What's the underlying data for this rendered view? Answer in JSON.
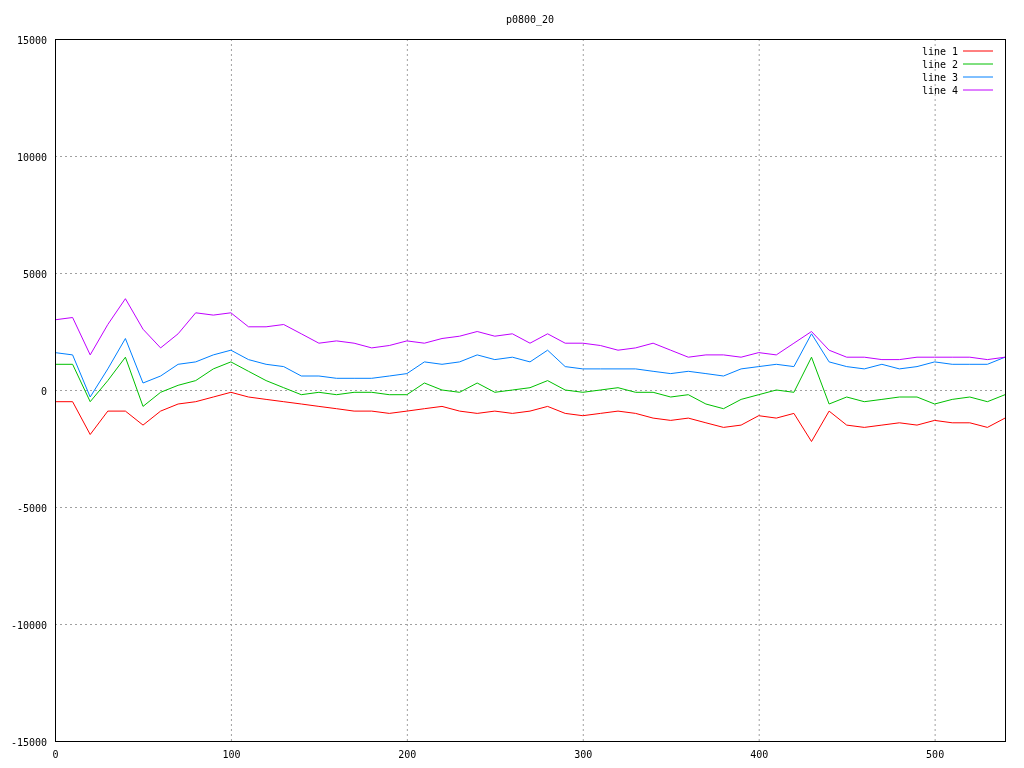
{
  "chart_data": {
    "type": "line",
    "title": "p0800_20",
    "x": [
      0,
      10,
      20,
      30,
      40,
      50,
      60,
      70,
      80,
      90,
      100,
      110,
      120,
      130,
      140,
      150,
      160,
      170,
      180,
      190,
      200,
      210,
      220,
      230,
      240,
      250,
      260,
      270,
      280,
      290,
      300,
      310,
      320,
      330,
      340,
      350,
      360,
      370,
      380,
      390,
      400,
      410,
      420,
      430,
      440,
      450,
      460,
      470,
      480,
      490,
      500,
      510,
      520,
      530,
      540
    ],
    "series": [
      {
        "name": "line 1",
        "color": "#ff0000",
        "values": [
          -500,
          -500,
          -1900,
          -900,
          -900,
          -1500,
          -900,
          -600,
          -500,
          -300,
          -100,
          -300,
          -400,
          -500,
          -600,
          -700,
          -800,
          -900,
          -900,
          -1000,
          -900,
          -800,
          -700,
          -900,
          -1000,
          -900,
          -1000,
          -900,
          -700,
          -1000,
          -1100,
          -1000,
          -900,
          -1000,
          -1200,
          -1300,
          -1200,
          -1400,
          -1600,
          -1500,
          -1100,
          -1200,
          -1000,
          -2200,
          -900,
          -1500,
          -1600,
          -1500,
          -1400,
          -1500,
          -1300,
          -1400,
          -1400,
          -1600,
          -1200
        ]
      },
      {
        "name": "line 2",
        "color": "#00c000",
        "values": [
          1100,
          1100,
          -500,
          400,
          1400,
          -700,
          -100,
          200,
          400,
          900,
          1200,
          800,
          400,
          100,
          -200,
          -100,
          -200,
          -100,
          -100,
          -200,
          -200,
          300,
          0,
          -100,
          300,
          -100,
          0,
          100,
          400,
          0,
          -100,
          0,
          100,
          -100,
          -100,
          -300,
          -200,
          -600,
          -800,
          -400,
          -200,
          0,
          -100,
          1400,
          -600,
          -300,
          -500,
          -400,
          -300,
          -300,
          -600,
          -400,
          -300,
          -500,
          -200
        ]
      },
      {
        "name": "line 3",
        "color": "#0080ff",
        "values": [
          1600,
          1500,
          -300,
          900,
          2200,
          300,
          600,
          1100,
          1200,
          1500,
          1700,
          1300,
          1100,
          1000,
          600,
          600,
          500,
          500,
          500,
          600,
          700,
          1200,
          1100,
          1200,
          1500,
          1300,
          1400,
          1200,
          1700,
          1000,
          900,
          900,
          900,
          900,
          800,
          700,
          800,
          700,
          600,
          900,
          1000,
          1100,
          1000,
          2400,
          1200,
          1000,
          900,
          1100,
          900,
          1000,
          1200,
          1100,
          1100,
          1100,
          1400
        ]
      },
      {
        "name": "line 4",
        "color": "#c000ff",
        "values": [
          3000,
          3100,
          1500,
          2800,
          3900,
          2600,
          1800,
          2400,
          3300,
          3200,
          3300,
          2700,
          2700,
          2800,
          2400,
          2000,
          2100,
          2000,
          1800,
          1900,
          2100,
          2000,
          2200,
          2300,
          2500,
          2300,
          2400,
          2000,
          2400,
          2000,
          2000,
          1900,
          1700,
          1800,
          2000,
          1700,
          1400,
          1500,
          1500,
          1400,
          1600,
          1500,
          2000,
          2500,
          1700,
          1400,
          1400,
          1300,
          1300,
          1400,
          1400,
          1400,
          1400,
          1300,
          1400
        ]
      }
    ],
    "xlim": [
      0,
      540
    ],
    "ylim": [
      -15000,
      15000
    ],
    "xticks": [
      0,
      100,
      200,
      300,
      400,
      500
    ],
    "yticks": [
      -15000,
      -10000,
      -5000,
      0,
      5000,
      10000,
      15000
    ],
    "grid": true,
    "legend": true
  }
}
